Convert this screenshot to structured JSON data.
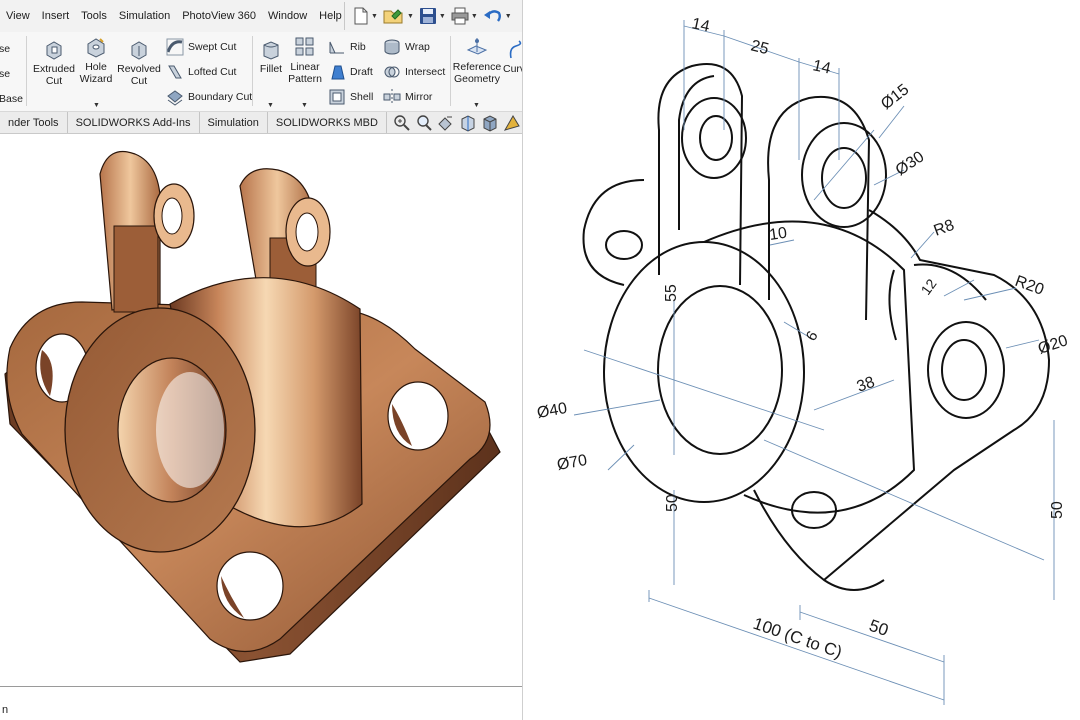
{
  "menu": {
    "items": [
      "View",
      "Insert",
      "Tools",
      "Simulation",
      "PhotoView 360",
      "Window",
      "Help"
    ]
  },
  "ribbon": {
    "partial_top": "se",
    "partial_mid": "se",
    "partial_base": "Base",
    "extruded_cut": [
      "Extruded",
      "Cut"
    ],
    "hole_wizard": [
      "Hole",
      "Wizard"
    ],
    "revolved_cut": [
      "Revolved",
      "Cut"
    ],
    "swept_cut": "Swept Cut",
    "lofted_cut": "Lofted Cut",
    "boundary_cut": "Boundary Cut",
    "fillet": "Fillet",
    "linear_pattern": [
      "Linear",
      "Pattern"
    ],
    "rib": "Rib",
    "draft": "Draft",
    "shell": "Shell",
    "wrap": "Wrap",
    "intersect": "Intersect",
    "mirror": "Mirror",
    "reference_geometry": [
      "Reference",
      "Geometry"
    ],
    "curves": "Curv"
  },
  "tabs": [
    "nder Tools",
    "SOLIDWORKS Add-Ins",
    "Simulation",
    "SOLIDWORKS MBD"
  ],
  "status": "n",
  "drawing": {
    "dims": {
      "d14a": "14",
      "d25": "25",
      "d14b": "14",
      "dia15": "Ø15",
      "dia30": "Ø30",
      "r8": "R8",
      "d10": "10",
      "r20": "R20",
      "d12": "12",
      "dia20": "Ø20",
      "d55": "55",
      "d6": "6",
      "d38": "38",
      "dia40": "Ø40",
      "dia70": "Ø70",
      "d50a": "50",
      "d50b": "50",
      "cc": "100 (C to C)",
      "d50c": "50"
    }
  },
  "colors": {
    "bronze_light": "#f3cfa8",
    "bronze_mid": "#c8875c",
    "bronze_dark": "#6d3c22",
    "ribbon_bg": "#f7f7f7",
    "menu_bg": "#f2f2f2",
    "dim_line": "#6c8fb5"
  }
}
